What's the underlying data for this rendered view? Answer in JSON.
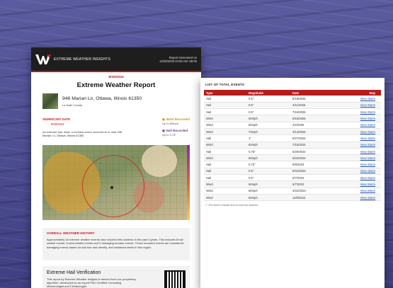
{
  "report": {
    "brand": "EXTREME WEATHER INSIGHTS",
    "generated_label": "Report Generated on",
    "generated_at": "10/28/2025 04:55 AM -08:00",
    "report_date": "8/29/2024",
    "title": "Extreme Weather Report",
    "address": "946 Marian Ln, Ottawa, Illinois 61350",
    "county": "La Salle County",
    "significant_label": "SIGNIFICANT DATE",
    "significant_date": "8/29/2024",
    "significant_desc": "An extreme hail, wind, or tornado event occurred at or near 946 Marian Ln, Ottawa, Illinois 61350",
    "wind_recorded": "Wind Recorded",
    "wind_value": "Up to 80mph",
    "hail_recorded": "Hail Recorded",
    "hail_value": "Up to 0.75\"",
    "history_title": "OVERALL WEATHER HISTORY",
    "history_text": "Approximately 16 extreme weather events have touched this address in the past 3 years. This includes 8 hail related events, 8 wind related events and 0 damaging tornado events. These recorded events are considered damaging events based on hail size and density, and sustained winds in this region.",
    "verify_title": "Extreme Hail Verification",
    "verify_text": "This report by Extreme Weather Insights is derived from our proprietary algorithm, developed by an expert PhD Certified Consulting Meteorologist and Climatologist."
  },
  "events": {
    "title": "LIST OF TOTAL EVENTS",
    "columns": [
      "Type",
      "Magnitude",
      "Date",
      "Map"
    ],
    "rows": [
      {
        "type": "Hail",
        "magnitude": "0.5\"",
        "date": "8/18/2025",
        "map": "View Storm"
      },
      {
        "type": "Hail",
        "magnitude": "0.5\"",
        "date": "4/11/2025",
        "map": "View Storm"
      },
      {
        "type": "Hail",
        "magnitude": "0.5\"",
        "date": "7/24/2025",
        "map": "View Storm"
      },
      {
        "type": "Wind",
        "magnitude": "50mph",
        "date": "5/16/2025",
        "map": "View Storm"
      },
      {
        "type": "Wind",
        "magnitude": "50mph",
        "date": "4/2/2025",
        "map": "View Storm"
      },
      {
        "type": "Wind",
        "magnitude": "70mph",
        "date": "3/14/2025",
        "map": "View Storm"
      },
      {
        "type": "Hail",
        "magnitude": "1\"",
        "date": "8/27/2024",
        "map": "View Storm"
      },
      {
        "type": "Wind",
        "magnitude": "60mph",
        "date": "7/15/2024",
        "map": "View Storm"
      },
      {
        "type": "Hail",
        "magnitude": "0.75\"",
        "date": "6/20/2024",
        "map": "View Storm"
      },
      {
        "type": "Wind",
        "magnitude": "50mph",
        "date": "6/22/2024",
        "map": "View Storm"
      },
      {
        "type": "Hail",
        "magnitude": "0.75\"",
        "date": "9/8/2023",
        "map": "View Storm"
      },
      {
        "type": "Hail",
        "magnitude": "0.5\"",
        "date": "8/31/2023",
        "map": "View Storm"
      },
      {
        "type": "Hail",
        "magnitude": "0.5\"",
        "date": "5/7/2023",
        "map": "View Storm"
      },
      {
        "type": "Wind",
        "magnitude": "60mph",
        "date": "5/7/2023",
        "map": "View Storm"
      },
      {
        "type": "Wind",
        "magnitude": "50mph",
        "date": "3/31/2023",
        "map": "View Storm"
      },
      {
        "type": "Wind",
        "magnitude": "50mph",
        "date": "11/5/2022",
        "map": "View Storm"
      }
    ],
    "footnote": "The storm's impact area is near the address"
  }
}
